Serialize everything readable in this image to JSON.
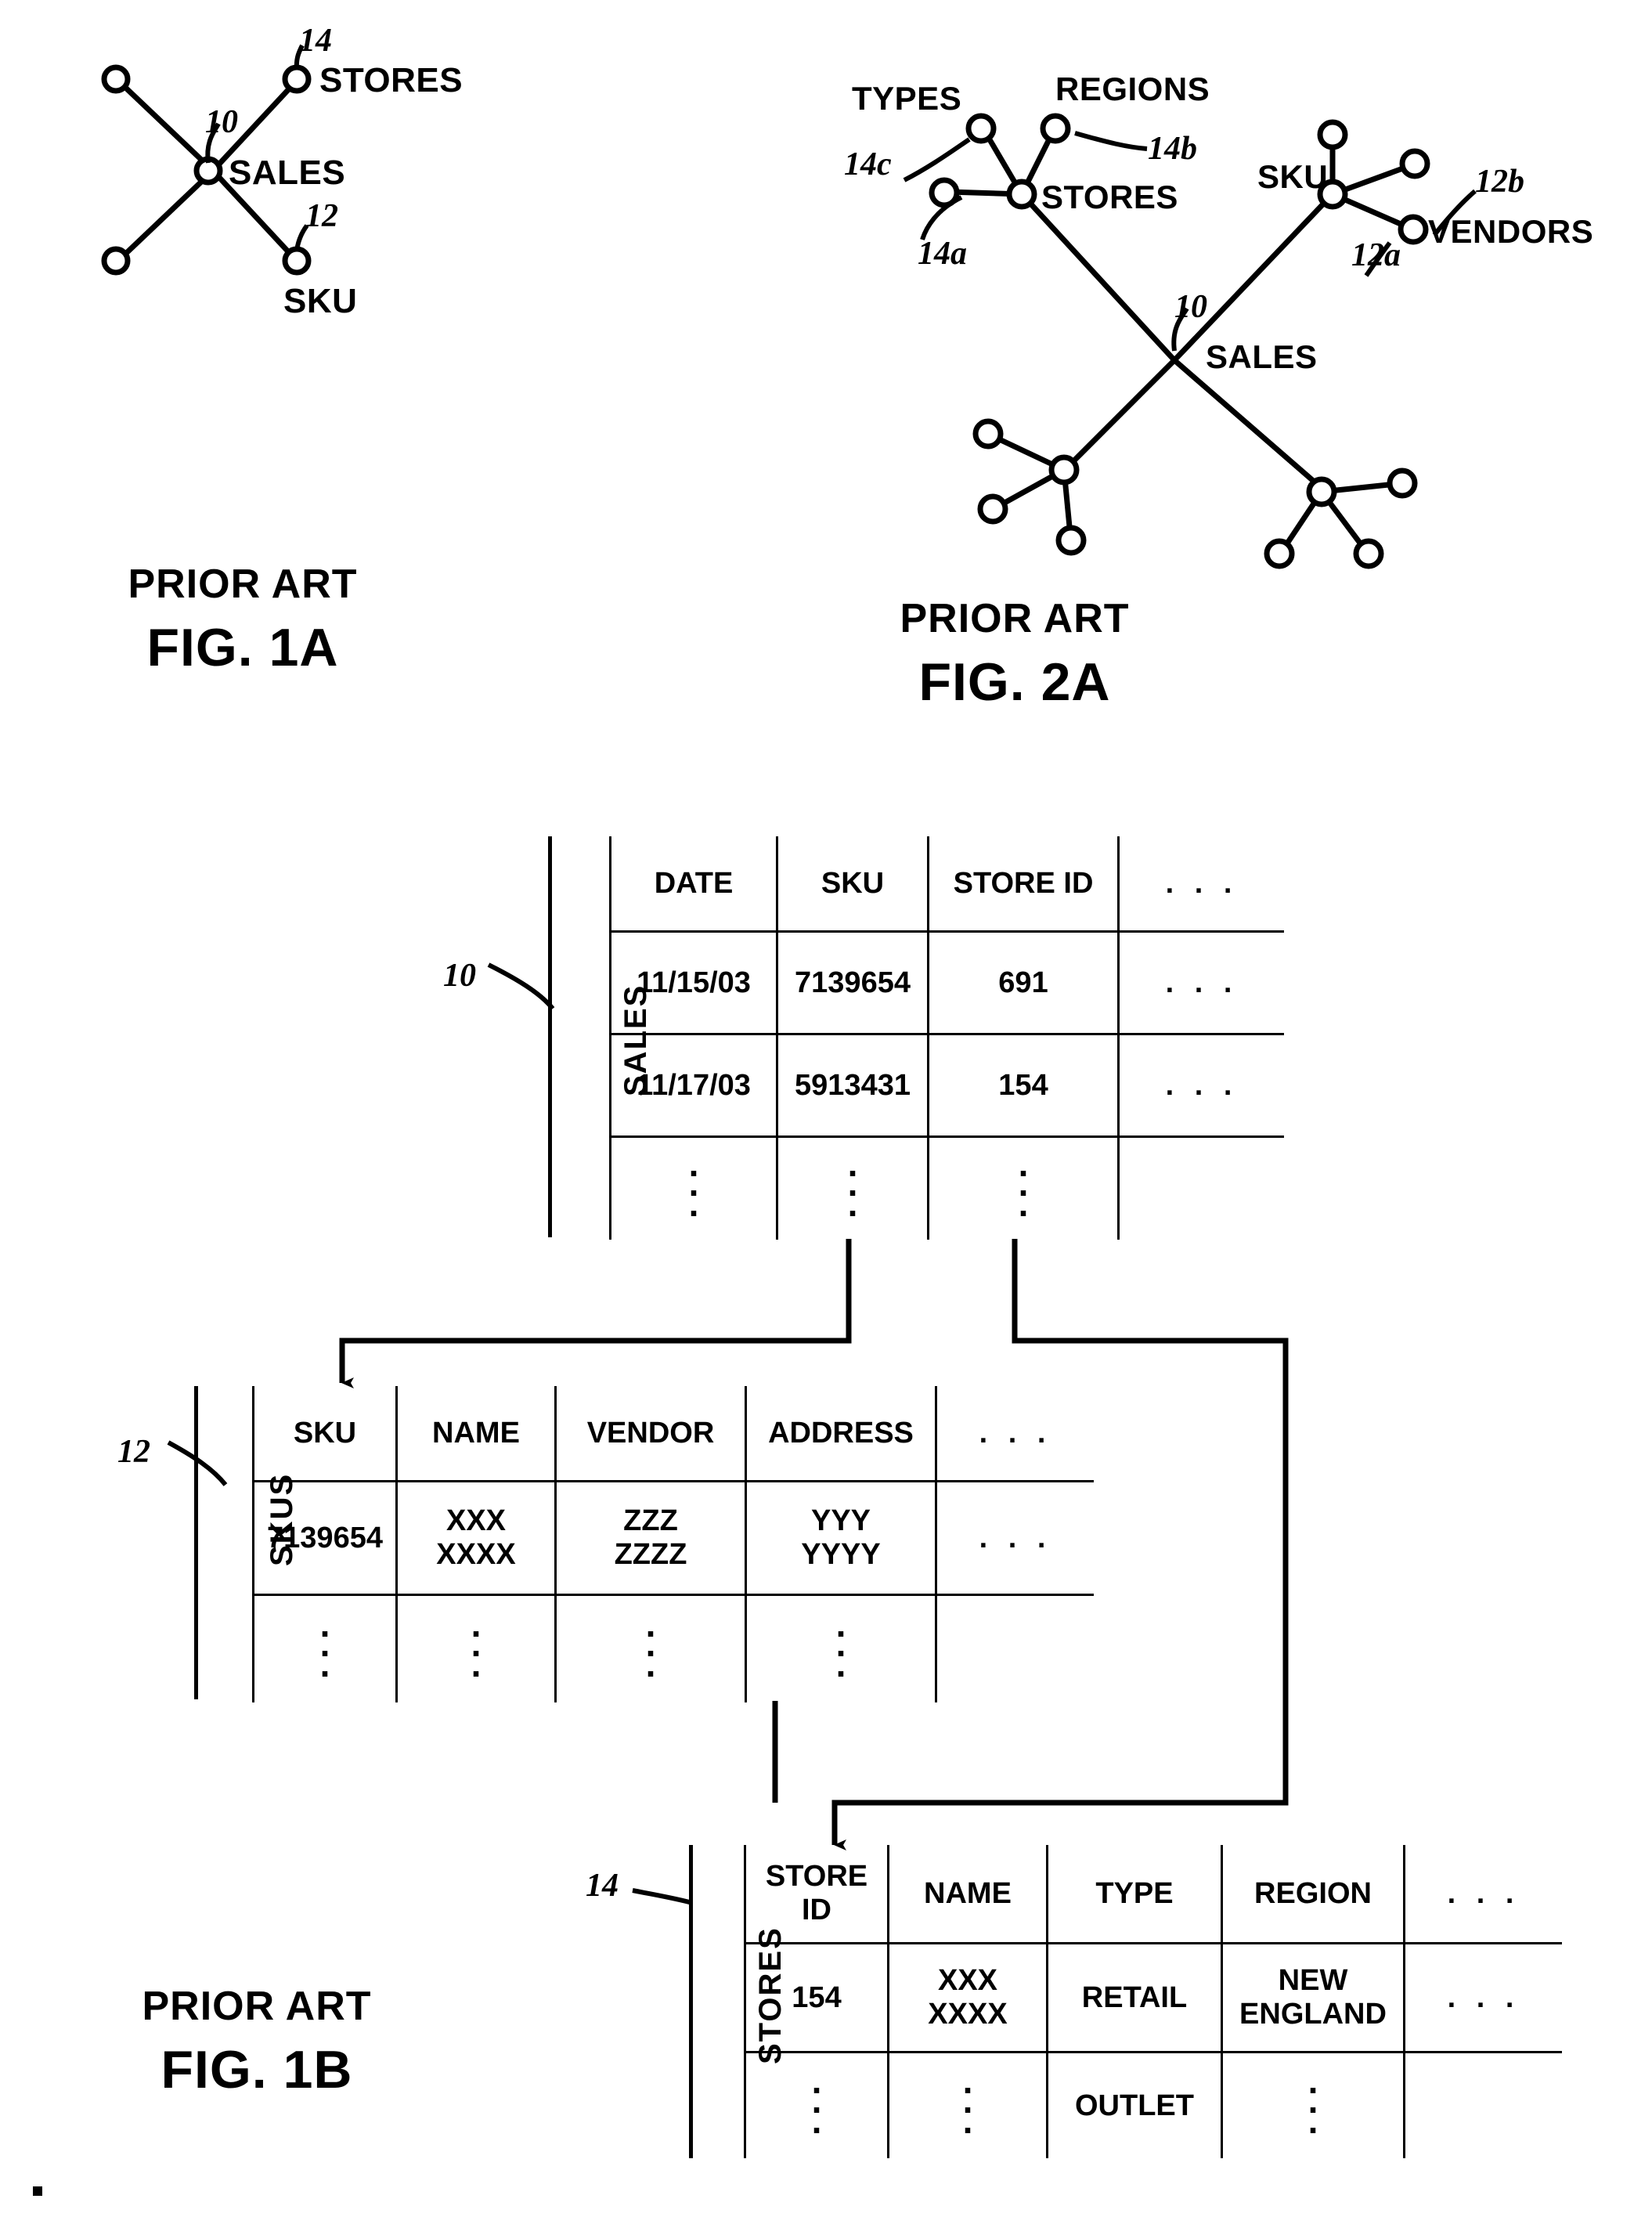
{
  "figures": {
    "fig1a": {
      "prior_art": "PRIOR ART",
      "caption": "FIG. 1A",
      "center_label": "SALES",
      "center_ref": "10",
      "nodes": [
        {
          "label": "STORES",
          "ref": "14"
        },
        {
          "label": "SKU",
          "ref": "12"
        }
      ]
    },
    "fig2a": {
      "prior_art": "PRIOR ART",
      "caption": "FIG. 2A",
      "center_label": "SALES",
      "center_ref": "10",
      "stores_label": "STORES",
      "stores_ref": "14a",
      "types_label": "TYPES",
      "types_ref": "14c",
      "regions_label": "REGIONS",
      "regions_ref": "14b",
      "sku_label": "SKU",
      "sku_ref": "12a",
      "vendors_label": "VENDORS",
      "vendors_ref": "12b"
    },
    "fig1b": {
      "prior_art": "PRIOR ART",
      "caption": "FIG. 1B",
      "ellipsis_h": ". . .",
      "tables": [
        {
          "name": "SALES",
          "ref": "10",
          "headers": [
            "DATE",
            "SKU",
            "STORE ID",
            ". . ."
          ],
          "rows": [
            [
              "11/15/03",
              "7139654",
              "691",
              ". . ."
            ],
            [
              "11/17/03",
              "5913431",
              "154",
              ". . ."
            ]
          ],
          "last_row": [
            ":",
            ":",
            ":",
            ""
          ]
        },
        {
          "name": "SKUS",
          "ref": "12",
          "headers": [
            "SKU",
            "NAME",
            "VENDOR",
            "ADDRESS",
            ". . ."
          ],
          "rows": [
            [
              "7139654",
              "XXX\nXXXX",
              "ZZZ\nZZZZ",
              "YYY\nYYYY",
              ". . ."
            ]
          ],
          "last_row": [
            ":",
            ":",
            ":",
            ":",
            ""
          ]
        },
        {
          "name": "STORES",
          "ref": "14",
          "headers": [
            "STORE\nID",
            "NAME",
            "TYPE",
            "REGION",
            ". . ."
          ],
          "rows": [
            [
              "154",
              "XXX\nXXXX",
              "RETAIL",
              "NEW\nENGLAND",
              ". . ."
            ]
          ],
          "last_row": [
            ":",
            ":",
            "OUTLET",
            ":",
            ""
          ]
        }
      ]
    }
  },
  "colors": {
    "ink": "#000000",
    "paper": "#ffffff"
  }
}
